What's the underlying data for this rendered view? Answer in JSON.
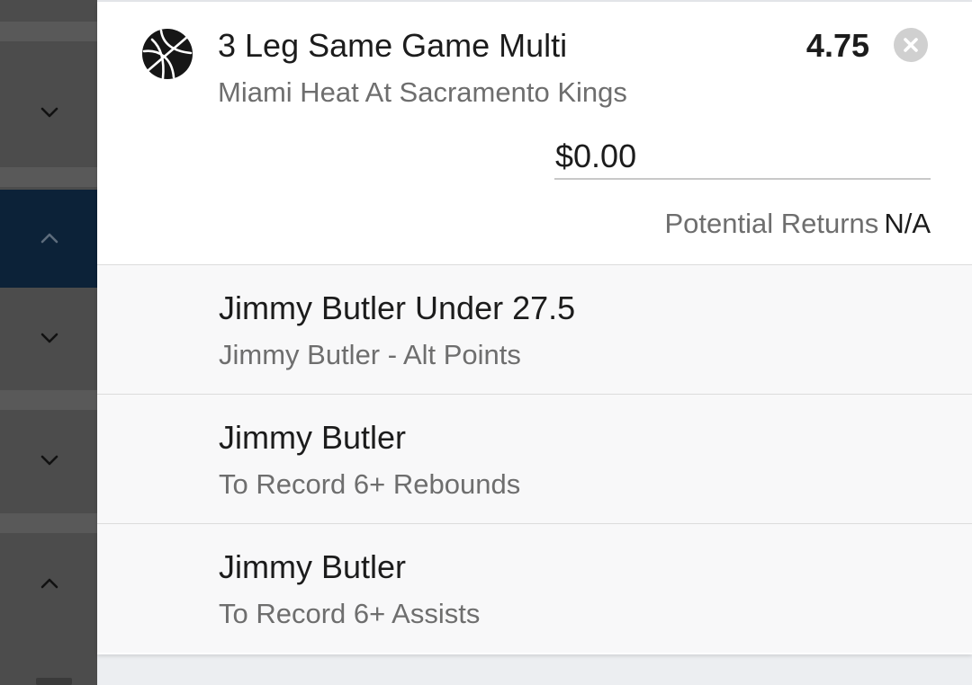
{
  "betslip": {
    "title": "3 Leg Same Game Multi",
    "odds": "4.75",
    "match": "Miami Heat At Sacramento Kings",
    "stake": {
      "value": "$0.00"
    },
    "returns_label": "Potential Returns",
    "returns_value": "N/A",
    "icon": "basketball-icon",
    "remove_icon": "close-icon"
  },
  "legs": [
    {
      "title": "Jimmy Butler Under 27.5",
      "subtitle": "Jimmy Butler - Alt Points"
    },
    {
      "title": "Jimmy Butler",
      "subtitle": "To Record 6+ Rebounds"
    },
    {
      "title": "Jimmy Butler",
      "subtitle": "To Record 6+ Assists"
    }
  ],
  "rail": {
    "chevrons": [
      "chevron-down-icon",
      "chevron-up-icon",
      "chevron-down-icon",
      "chevron-down-icon",
      "chevron-up-icon"
    ]
  },
  "colors": {
    "active_rail": "#0c2238",
    "rail": "#4c4c4c",
    "leg_background": "#f8f8f9",
    "text_primary": "#1c1c1c",
    "text_secondary": "#6e6e6e"
  }
}
